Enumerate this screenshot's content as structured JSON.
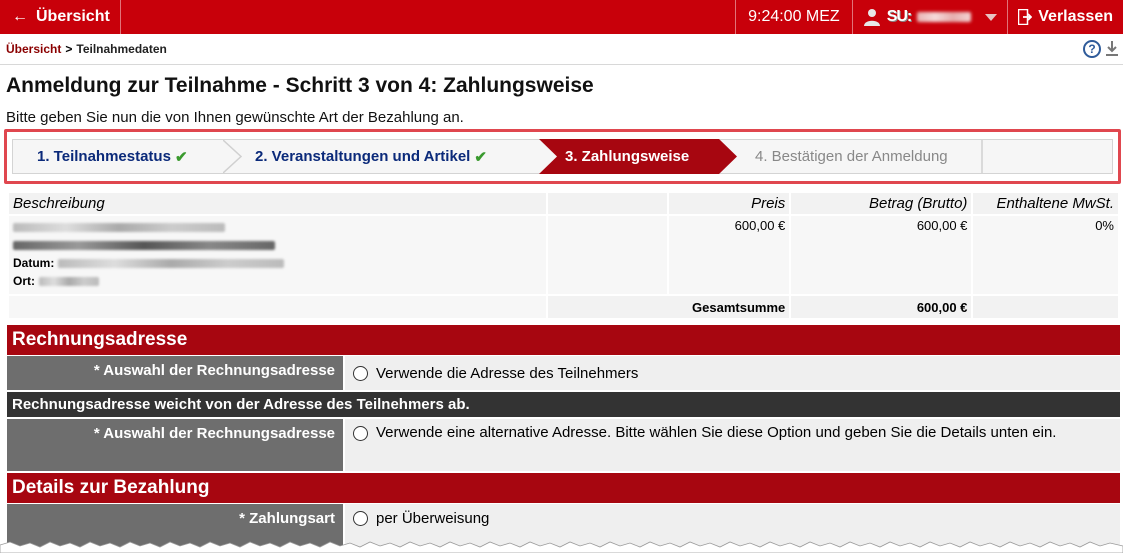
{
  "topbar": {
    "back_label": "Übersicht",
    "time": "9:24:00 MEZ",
    "user_prefix": "SU:",
    "exit_label": "Verlassen"
  },
  "breadcrumb": {
    "link": "Übersicht",
    "separator": ">",
    "current": "Teilnahmedaten"
  },
  "page": {
    "title": "Anmeldung zur Teilnahme - Schritt 3 von 4: Zahlungsweise",
    "intro": "Bitte geben Sie nun die von Ihnen gewünschte Art der Bezahlung an."
  },
  "steps": [
    {
      "label": "1. Teilnahmestatus",
      "check": "✔"
    },
    {
      "label": "2. Veranstaltungen und Artikel",
      "check": "✔"
    },
    {
      "label": "3. Zahlungsweise"
    },
    {
      "label": "4. Bestätigen der Anmeldung"
    }
  ],
  "table": {
    "headers": [
      "Beschreibung",
      "",
      "Preis",
      "Betrag (Brutto)",
      "Enthaltene MwSt."
    ],
    "row": {
      "date_label": "Datum:",
      "place_label": "Ort:",
      "price": "600,00 €",
      "amount": "600,00 €",
      "vat": "0%"
    },
    "total_label": "Gesamtsumme",
    "total_value": "600,00 €"
  },
  "billing": {
    "section_title": "Rechnungsadresse",
    "field_label": "* Auswahl der Rechnungsadresse",
    "option_participant": "Verwende die Adresse des Teilnehmers",
    "subheader": "Rechnungsadresse weicht von der Adresse des Teilnehmers ab.",
    "field_label_2": "* Auswahl der Rechnungsadresse",
    "option_alternative": "Verwende eine alternative Adresse. Bitte wählen Sie diese Option und geben Sie die Details unten ein."
  },
  "payment": {
    "section_title": "Details zur Bezahlung",
    "field_label": "* Zahlungsart",
    "option_transfer": "per Überweisung"
  },
  "colors": {
    "brand_red": "#c8000a",
    "section_red": "#a70610",
    "step_done": "#0b2a7a",
    "check_green": "#3a9a2e"
  }
}
